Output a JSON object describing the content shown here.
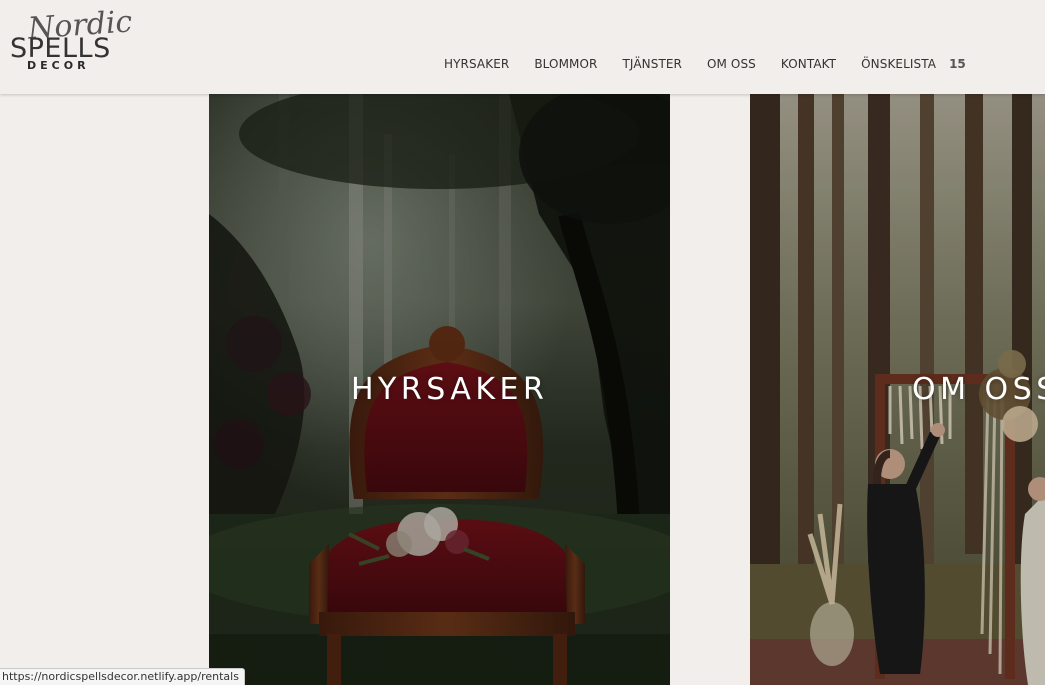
{
  "brand": {
    "script": "Nordic",
    "main": "SPELLS",
    "sub": "DECOR"
  },
  "nav": {
    "items": [
      {
        "label": "HYRSAKER"
      },
      {
        "label": "BLOMMOR"
      },
      {
        "label": "TJÄNSTER"
      },
      {
        "label": "OM OSS"
      },
      {
        "label": "KONTAKT"
      },
      {
        "label": "ÖNSKELISTA"
      }
    ],
    "wishlist_count": "15"
  },
  "tiles": {
    "rentals": {
      "title": "HYRSAKER"
    },
    "about": {
      "title": "OM OSS"
    }
  },
  "status_bar": {
    "url": "https://nordicspellsdecor.netlify.app/rentals"
  },
  "colors": {
    "background": "#f1eeec",
    "text": "#333333",
    "chair_red": "#6e1218",
    "forest_dark": "#1b1f16"
  },
  "icons": {
    "wishlist": "wishlist-count-badge"
  }
}
